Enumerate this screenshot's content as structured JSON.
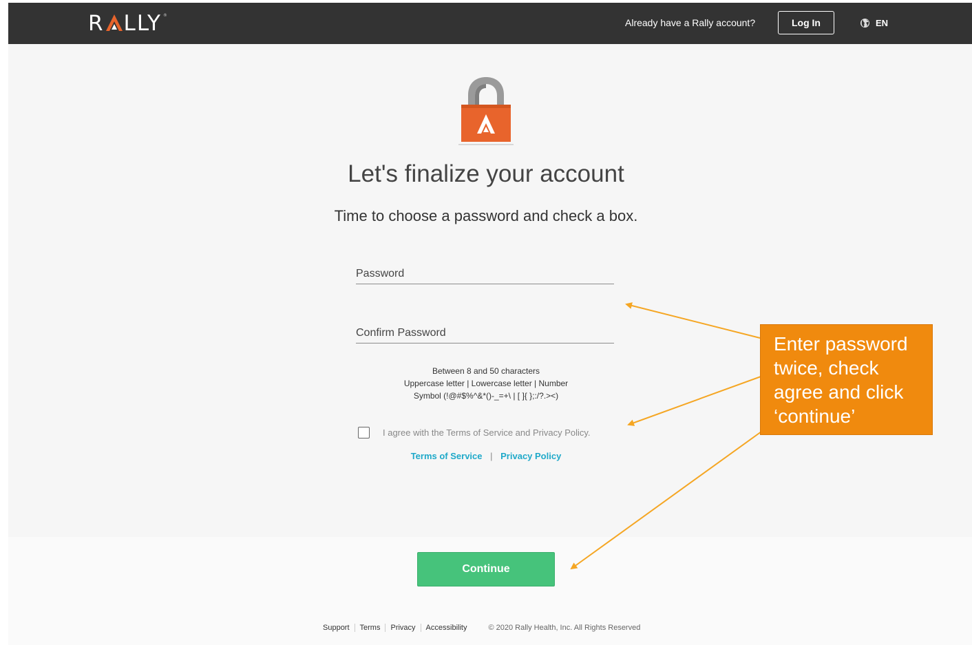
{
  "header": {
    "logo_text": "RALLY",
    "logo_reg": "®",
    "already_text": "Already have a Rally account?",
    "login_label": "Log In",
    "lang_label": "EN",
    "lang_icon": "globe-icon"
  },
  "main": {
    "lock_icon": "lock-icon",
    "title": "Let's finalize your account",
    "subtitle": "Time to choose a password and check a box.",
    "password_placeholder": "Password",
    "confirm_placeholder": "Confirm Password",
    "rules": [
      "Between 8 and 50 characters",
      "Uppercase letter | Lowercase letter | Number",
      "Symbol (!@#$%^&*()-_=+\\ | [ ]{ };:/?.><)"
    ],
    "agree_text": "I agree with the Terms of Service and Privacy Policy.",
    "terms_link": "Terms of Service",
    "link_sep": "|",
    "privacy_link": "Privacy Policy",
    "continue_label": "Continue"
  },
  "footer": {
    "support": "Support",
    "terms": "Terms",
    "privacy": "Privacy",
    "accessibility": "Accessibility",
    "copyright": "© 2020 Rally Health, Inc. All Rights Reserved"
  },
  "annotation": {
    "callout_lines": [
      "Enter password",
      "twice, check",
      "agree and click",
      "‘continue’"
    ],
    "color": "#f08a0e"
  },
  "colors": {
    "header_bg": "#333333",
    "brand_orange": "#e8642c",
    "continue_green": "#46c37b",
    "link_blue": "#1fa9c9"
  }
}
